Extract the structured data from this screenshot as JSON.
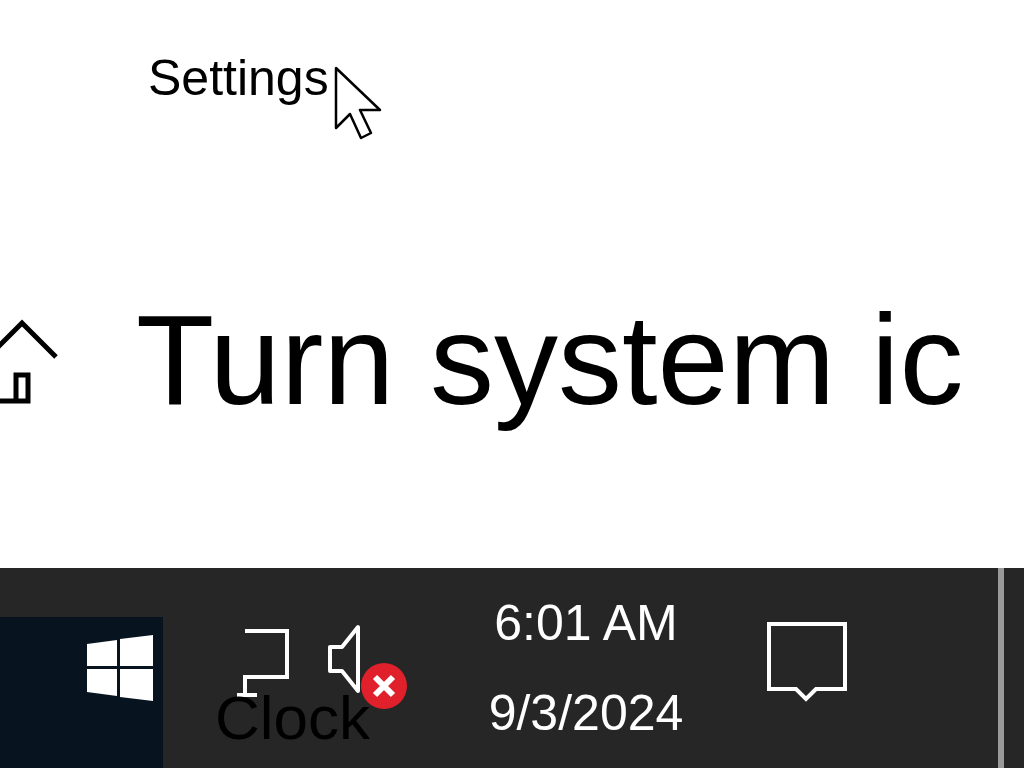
{
  "window": {
    "title": "Settings"
  },
  "page": {
    "heading": "Turn system ic"
  },
  "drag_label": "Clock",
  "taskbar": {
    "clock": {
      "time": "6:01 AM",
      "date": "9/3/2024"
    },
    "volume": {
      "muted": true
    }
  }
}
